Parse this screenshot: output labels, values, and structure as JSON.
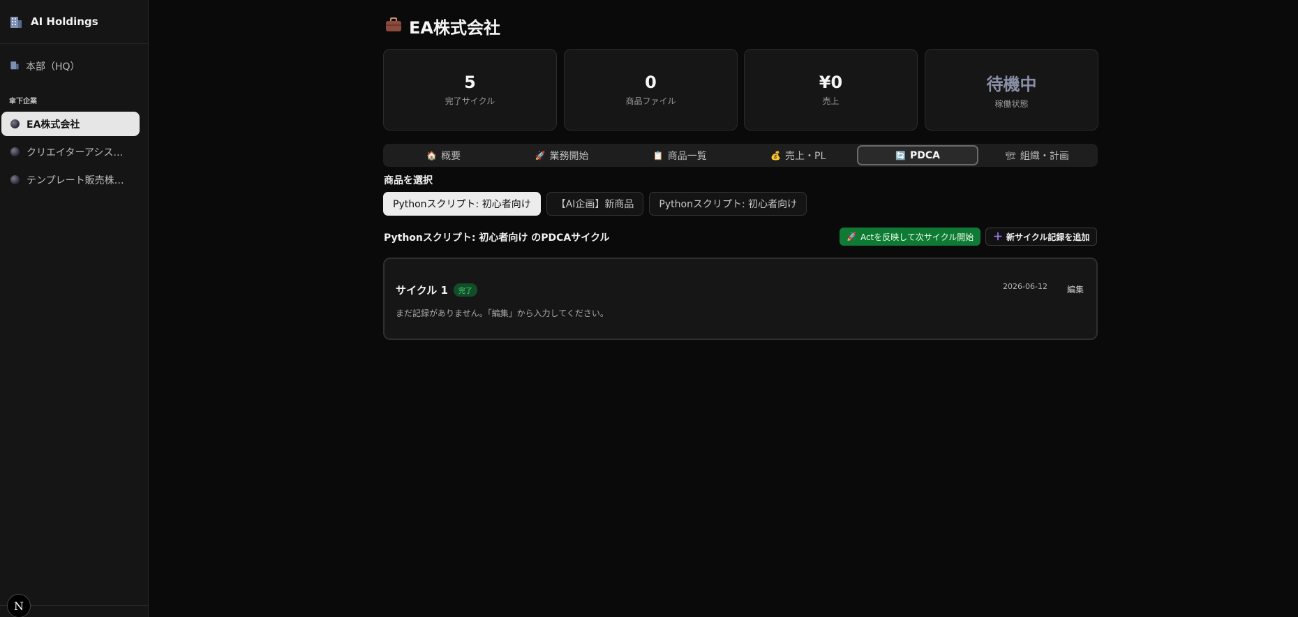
{
  "sidebar": {
    "brand": "AI Holdings",
    "hq_label": "本部（HQ）",
    "section_label": "傘下企業",
    "companies": [
      {
        "label": "EA株式会社",
        "active": true
      },
      {
        "label": "クリエイターアシス…",
        "active": false
      },
      {
        "label": "テンプレート販売株…",
        "active": false
      }
    ],
    "next_badge": "N"
  },
  "page": {
    "title": "EA株式会社",
    "stats": [
      {
        "value": "5",
        "label": "完了サイクル"
      },
      {
        "value": "0",
        "label": "商品ファイル"
      },
      {
        "value": "¥0",
        "label": "売上"
      },
      {
        "value": "待機中",
        "label": "稼働状態"
      }
    ],
    "tabs": [
      {
        "icon": "🏠",
        "label": "概要"
      },
      {
        "icon": "🚀",
        "label": "業務開始"
      },
      {
        "icon": "📋",
        "label": "商品一覧"
      },
      {
        "icon": "💰",
        "label": "売上・PL"
      },
      {
        "icon": "🔄",
        "label": "PDCA",
        "active": true
      },
      {
        "icon": "🏗",
        "label": "組織・計画"
      }
    ],
    "product_select_label": "商品を選択",
    "products": [
      {
        "label": "Pythonスクリプト: 初心者向け",
        "active": true
      },
      {
        "label": "【AI企画】新商品",
        "active": false
      },
      {
        "label": "Pythonスクリプト: 初心者向け",
        "active": false
      }
    ],
    "cycle_heading": "Pythonスクリプト: 初心者向け のPDCAサイクル",
    "act_button": "Actを反映して次サイクル開始",
    "add_button": "新サイクル記録を追加",
    "cycle": {
      "name": "サイクル 1",
      "status": "完了",
      "date": "2026-06-12",
      "edit": "編集",
      "note": "まだ記録がありません。「編集」から入力してください。"
    }
  },
  "colors": {
    "background": "#0a0a0a",
    "sidebar": "#151515",
    "active_green": "#0f7a35",
    "accent_purple": "#a983ff"
  }
}
